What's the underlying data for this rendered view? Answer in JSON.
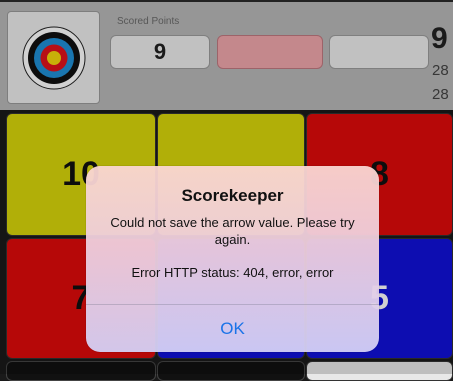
{
  "header": {
    "scored_label": "Scored Points",
    "current_score": "9",
    "total": "9",
    "side_values": [
      "28",
      "28"
    ]
  },
  "keypad": {
    "row1": [
      "10",
      "",
      "8"
    ],
    "row2": [
      "7",
      "",
      "5"
    ]
  },
  "alert": {
    "title": "Scorekeeper",
    "message": "Could not save the arrow value. Please try again.",
    "error": "Error HTTP status: 404, error, error",
    "ok_label": "OK"
  },
  "colors": {
    "yellow": "#d8d60a",
    "red": "#df0a0a",
    "blue": "#1010d8",
    "ok_blue": "#1a73e8"
  },
  "icons": {
    "target": "archery-target-icon"
  }
}
